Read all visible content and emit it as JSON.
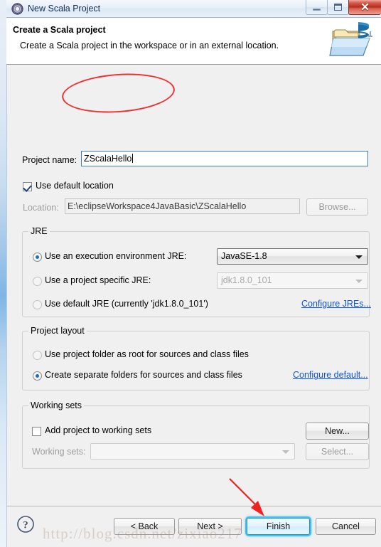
{
  "window": {
    "title": "New Scala Project",
    "icon": "scala-gear-icon",
    "controls": {
      "minimize": "minimize-button",
      "maximize": "maximize-button",
      "close_glyph": "✕"
    }
  },
  "header": {
    "title": "Create a Scala project",
    "subtitle": "Create a Scala project in the workspace or in an external location.",
    "icon": "scala-project-folder-icon"
  },
  "form": {
    "project_name_label": "Project name:",
    "project_name_value": "ZScalaHello",
    "use_default_location_label": "Use default location",
    "use_default_location_checked": true,
    "location_label": "Location:",
    "location_value": "E:\\eclipseWorkspace4JavaBasic\\ZScalaHello",
    "browse_label": "Browse..."
  },
  "jre": {
    "group_title": "JRE",
    "options": [
      {
        "label": "Use an execution environment JRE:",
        "selected": true
      },
      {
        "label": "Use a project specific JRE:",
        "selected": false
      },
      {
        "label": "Use default JRE (currently 'jdk1.8.0_101')",
        "selected": false
      }
    ],
    "execution_env_value": "JavaSE-1.8",
    "specific_jre_value": "jdk1.8.0_101",
    "configure_link": "Configure JREs..."
  },
  "project_layout": {
    "group_title": "Project layout",
    "options": [
      {
        "label": "Use project folder as root for sources and class files",
        "selected": false
      },
      {
        "label": "Create separate folders for sources and class files",
        "selected": true
      }
    ],
    "configure_link": "Configure default..."
  },
  "working_sets": {
    "group_title": "Working sets",
    "add_label": "Add project to working sets",
    "add_checked": false,
    "sets_label": "Working sets:",
    "sets_value": "",
    "new_label": "New...",
    "select_label": "Select..."
  },
  "footer": {
    "help_icon": "help-question-icon",
    "back_label": "< Back",
    "next_label": "Next >",
    "finish_label": "Finish",
    "cancel_label": "Cancel"
  },
  "annotations": {
    "ellipse": "red-ellipse-highlight-project-name",
    "arrow": "red-arrow-pointing-to-finish",
    "watermark": "http://blog.csdn.net/zixiao217"
  },
  "colors": {
    "accent": "#3c7fb1",
    "link": "#1155cc",
    "annotation": "#f03030",
    "body_bg": "#f0f0f0"
  }
}
